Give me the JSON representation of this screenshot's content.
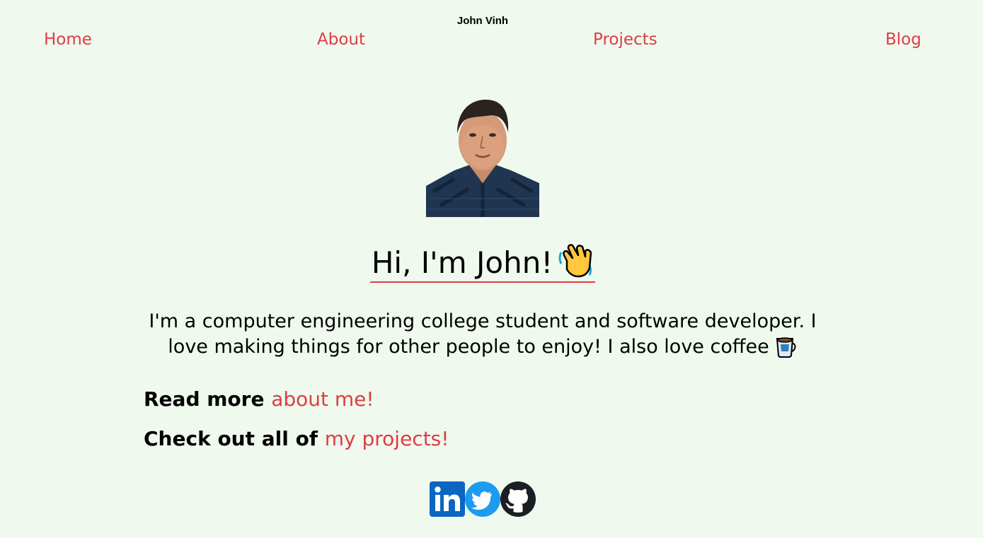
{
  "header": {
    "site_title": "John Vinh"
  },
  "nav": {
    "items": [
      {
        "label": "Home"
      },
      {
        "label": "About"
      },
      {
        "label": "Projects"
      },
      {
        "label": "Blog"
      }
    ]
  },
  "hero": {
    "heading": "Hi, I'm John!",
    "intro": "I'm a computer engineering college student and software developer. I love making things for other people to enjoy! I also love coffee",
    "cta_about_prefix": "Read more ",
    "cta_about_link": "about me!",
    "cta_projects_prefix": "Check out all of ",
    "cta_projects_link": "my projects!"
  },
  "icons": {
    "heading_icon": "waving-hand-icon",
    "intro_icon": "coffee-icon",
    "social": [
      "linkedin-icon",
      "twitter-icon",
      "github-icon"
    ]
  },
  "colors": {
    "background": "#f0f9ee",
    "accent": "#dd3d43",
    "linkedin": "#0a66c2",
    "twitter": "#1d9bf0",
    "github": "#1b1f23"
  }
}
